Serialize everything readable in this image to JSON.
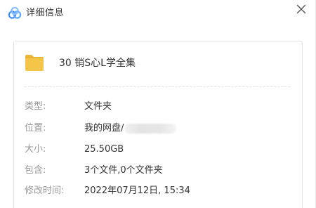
{
  "window": {
    "title": "详细信息"
  },
  "file": {
    "name": "30 销S心L学全集"
  },
  "details": [
    {
      "label": "类型:",
      "value": "文件夹"
    },
    {
      "label": "位置:",
      "value": "我的网盘/"
    },
    {
      "label": "大小:",
      "value": "25.50GB"
    },
    {
      "label": "包含:",
      "value": "3个文件,0个文件夹"
    },
    {
      "label": "修改时间:",
      "value": "2022年07月12日, 15:34"
    }
  ],
  "colors": {
    "folder": "#f5c54a",
    "folder_tab": "#e9b535",
    "logo_primary": "#3f8ff6",
    "logo_secondary": "#8bc0ff",
    "label_text": "#999999",
    "value_text": "#333333"
  },
  "icons": {
    "logo": "baidu-netdisk-logo-icon",
    "close": "close-icon",
    "folder": "folder-icon"
  }
}
